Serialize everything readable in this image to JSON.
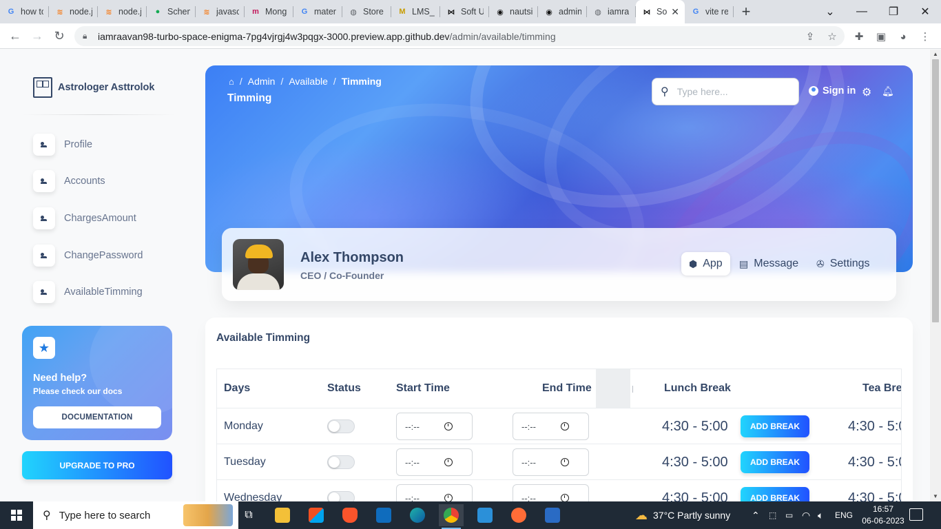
{
  "browser": {
    "tabs": [
      {
        "title": "how to",
        "icon": "google-icon",
        "color": "#4285f4"
      },
      {
        "title": "node.j",
        "icon": "stackoverflow-icon",
        "color": "#f48024"
      },
      {
        "title": "node.j",
        "icon": "stackoverflow-icon",
        "color": "#f48024"
      },
      {
        "title": "Schem",
        "icon": "mongodb-icon",
        "color": "#13aa52"
      },
      {
        "title": "javasc",
        "icon": "stackoverflow-icon",
        "color": "#f48024"
      },
      {
        "title": "Mong",
        "icon": "medium-icon",
        "color": "#c2185b"
      },
      {
        "title": "mater",
        "icon": "google-icon",
        "color": "#4285f4"
      },
      {
        "title": "Store",
        "icon": "globe-icon",
        "color": "#5f6368"
      },
      {
        "title": "LMS_",
        "icon": "lms-icon",
        "color": "#f5c400"
      },
      {
        "title": "Soft U",
        "icon": "bowtie-icon",
        "color": "#111111"
      },
      {
        "title": "nautsi",
        "icon": "github-icon",
        "color": "#111111"
      },
      {
        "title": "admin",
        "icon": "github-icon",
        "color": "#111111"
      },
      {
        "title": "iamra",
        "icon": "globe-icon",
        "color": "#5f6368"
      },
      {
        "title": "So",
        "icon": "bowtie-icon",
        "color": "#111111",
        "active": true
      },
      {
        "title": "vite re",
        "icon": "google-icon",
        "color": "#4285f4"
      }
    ],
    "url_host": "iamraavan98-turbo-space-enigma-7pg4vjrgj4w3pqgx-3000.preview.app.github.dev",
    "url_path": "/admin/available/timming"
  },
  "sidebar": {
    "brand": "Astrologer Asttrolok",
    "items": [
      {
        "label": "Profile"
      },
      {
        "label": "Accounts"
      },
      {
        "label": "ChargesAmount"
      },
      {
        "label": "ChangePassword"
      },
      {
        "label": "AvailableTimming"
      }
    ],
    "help": {
      "title": "Need help?",
      "subtitle": "Please check our docs",
      "button": "DOCUMENTATION"
    },
    "upgrade": "UPGRADE TO PRO"
  },
  "header": {
    "breadcrumbs": [
      "Admin",
      "Available",
      "Timming"
    ],
    "title": "Timming",
    "search_placeholder": "Type here...",
    "signin": "Sign in"
  },
  "profile": {
    "name": "Alex Thompson",
    "role": "CEO / Co-Founder",
    "tabs": [
      {
        "label": "App",
        "icon": "cube-icon"
      },
      {
        "label": "Message",
        "icon": "document-icon"
      },
      {
        "label": "Settings",
        "icon": "wrench-icon"
      }
    ]
  },
  "table": {
    "title": "Available Timming",
    "columns": [
      "Days",
      "Status",
      "Start Time",
      "End Time",
      "Lunch Break",
      "Tea Bre"
    ],
    "rows": [
      {
        "day": "Monday",
        "start": "--:--",
        "end": "--:--",
        "lunch": "4:30 - 5:00",
        "add": "ADD BREAK",
        "tea": "4:30 - 5:0"
      },
      {
        "day": "Tuesday",
        "start": "--:--",
        "end": "--:--",
        "lunch": "4:30 - 5:00",
        "add": "ADD BREAK",
        "tea": "4:30 - 5:0"
      },
      {
        "day": "Wednesday",
        "start": "--:--",
        "end": "--:--",
        "lunch": "4:30 - 5:00",
        "add": "ADD BREAK",
        "tea": "4:30 - 5:0"
      }
    ]
  },
  "taskbar": {
    "search_placeholder": "Type here to search",
    "weather": "37°C  Partly sunny",
    "language": "ENG",
    "time": "16:57",
    "date": "06-06-2023"
  }
}
